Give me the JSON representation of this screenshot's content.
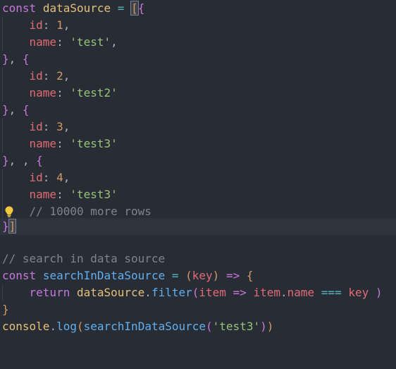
{
  "editor": {
    "theme_colors": {
      "background": "#282c34",
      "current_line": "#2f333d",
      "keyword": "#c678dd",
      "variable": "#e5c07b",
      "property": "#e06c75",
      "number": "#d19a66",
      "string": "#98c379",
      "function": "#61afef",
      "operator": "#56b6c2",
      "comment": "#7f848e"
    },
    "lightbulb_icon": "lightbulb-icon",
    "tokens": {
      "const": "const",
      "dataSource": "dataSource",
      "eq": "=",
      "open_bracket": "[",
      "open_brace": "{",
      "close_brace": "}",
      "close_bracket": "]",
      "comma": ",",
      "comma_space": ", ",
      "id_key": "id",
      "name_key": "name",
      "colon": ":",
      "id_1": "1",
      "id_2": "2",
      "id_3": "3",
      "id_4": "4",
      "name_test": "'test'",
      "name_test2": "'test2'",
      "name_test3a": "'test3'",
      "name_test3b": "'test3'",
      "comment_more_rows": "// 10000 more rows",
      "comment_search": "// search in data source",
      "searchInDataSource": "searchInDataSource",
      "open_paren": "(",
      "close_paren": ")",
      "key_param": "key",
      "arrow": "=>",
      "return": "return",
      "dot": ".",
      "filter": "filter",
      "item": "item",
      "name_prop": "name",
      "strict_eq": "===",
      "key_ref": "key",
      "console": "console",
      "log": "log",
      "arg_test3": "'test3'"
    }
  }
}
